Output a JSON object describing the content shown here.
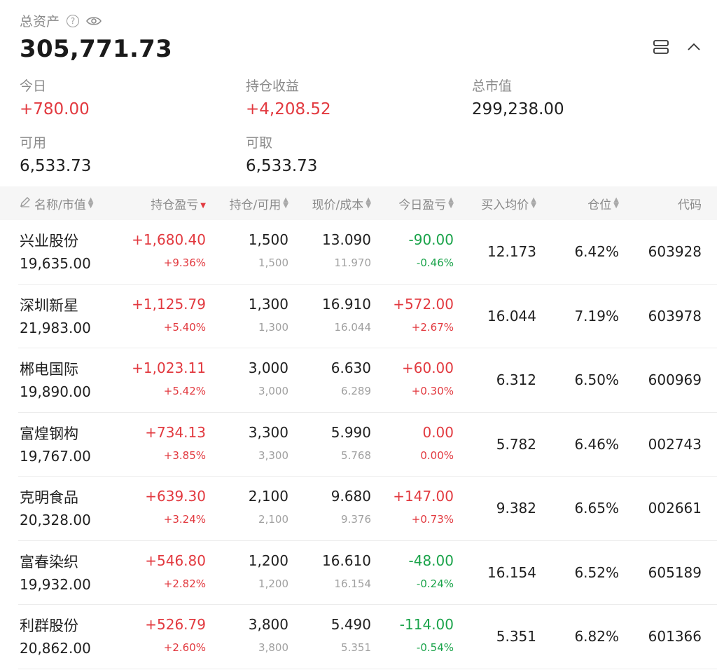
{
  "summary": {
    "total_label": "总资产",
    "total_value": "305,771.73",
    "today_label": "今日",
    "today_value": "+780.00",
    "holding_pl_label": "持仓收益",
    "holding_pl_value": "+4,208.52",
    "market_value_label": "总市值",
    "market_value_value": "299,238.00",
    "available_label": "可用",
    "available_value": "6,533.73",
    "withdrawable_label": "可取",
    "withdrawable_value": "6,533.73"
  },
  "icons": {
    "help": "help-circle-icon",
    "eye": "eye-icon",
    "layout": "layout-list-icon",
    "collapse": "chevron-up-icon",
    "edit": "pencil-icon"
  },
  "colors": {
    "up": "#e2393f",
    "down": "#1aa34a",
    "muted": "#8a8a8a",
    "header_bg": "#f6f6f6"
  },
  "table": {
    "headers": {
      "name": "名称/市值",
      "holding_pl": "持仓盈亏",
      "position": "持仓/可用",
      "price": "现价/成本",
      "today_pl": "今日盈亏",
      "avg_buy": "买入均价",
      "weight": "仓位",
      "code": "代码"
    },
    "rows": [
      {
        "name": "兴业股份",
        "market_value": "19,635.00",
        "pl": "+1,680.40",
        "pl_pct": "+9.36%",
        "pl_dir": "up",
        "holding": "1,500",
        "available": "1,500",
        "price": "13.090",
        "cost": "11.970",
        "today": "-90.00",
        "today_pct": "-0.46%",
        "today_dir": "down",
        "avg_buy": "12.173",
        "weight": "6.42%",
        "code": "603928"
      },
      {
        "name": "深圳新星",
        "market_value": "21,983.00",
        "pl": "+1,125.79",
        "pl_pct": "+5.40%",
        "pl_dir": "up",
        "holding": "1,300",
        "available": "1,300",
        "price": "16.910",
        "cost": "16.044",
        "today": "+572.00",
        "today_pct": "+2.67%",
        "today_dir": "up",
        "avg_buy": "16.044",
        "weight": "7.19%",
        "code": "603978"
      },
      {
        "name": "郴电国际",
        "market_value": "19,890.00",
        "pl": "+1,023.11",
        "pl_pct": "+5.42%",
        "pl_dir": "up",
        "holding": "3,000",
        "available": "3,000",
        "price": "6.630",
        "cost": "6.289",
        "today": "+60.00",
        "today_pct": "+0.30%",
        "today_dir": "up",
        "avg_buy": "6.312",
        "weight": "6.50%",
        "code": "600969"
      },
      {
        "name": "富煌钢构",
        "market_value": "19,767.00",
        "pl": "+734.13",
        "pl_pct": "+3.85%",
        "pl_dir": "up",
        "holding": "3,300",
        "available": "3,300",
        "price": "5.990",
        "cost": "5.768",
        "today": "0.00",
        "today_pct": "0.00%",
        "today_dir": "up",
        "avg_buy": "5.782",
        "weight": "6.46%",
        "code": "002743"
      },
      {
        "name": "克明食品",
        "market_value": "20,328.00",
        "pl": "+639.30",
        "pl_pct": "+3.24%",
        "pl_dir": "up",
        "holding": "2,100",
        "available": "2,100",
        "price": "9.680",
        "cost": "9.376",
        "today": "+147.00",
        "today_pct": "+0.73%",
        "today_dir": "up",
        "avg_buy": "9.382",
        "weight": "6.65%",
        "code": "002661"
      },
      {
        "name": "富春染织",
        "market_value": "19,932.00",
        "pl": "+546.80",
        "pl_pct": "+2.82%",
        "pl_dir": "up",
        "holding": "1,200",
        "available": "1,200",
        "price": "16.610",
        "cost": "16.154",
        "today": "-48.00",
        "today_pct": "-0.24%",
        "today_dir": "down",
        "avg_buy": "16.154",
        "weight": "6.52%",
        "code": "605189"
      },
      {
        "name": "利群股份",
        "market_value": "20,862.00",
        "pl": "+526.79",
        "pl_pct": "+2.60%",
        "pl_dir": "up",
        "holding": "3,800",
        "available": "3,800",
        "price": "5.490",
        "cost": "5.351",
        "today": "-114.00",
        "today_pct": "-0.54%",
        "today_dir": "down",
        "avg_buy": "5.351",
        "weight": "6.82%",
        "code": "601366"
      }
    ]
  }
}
